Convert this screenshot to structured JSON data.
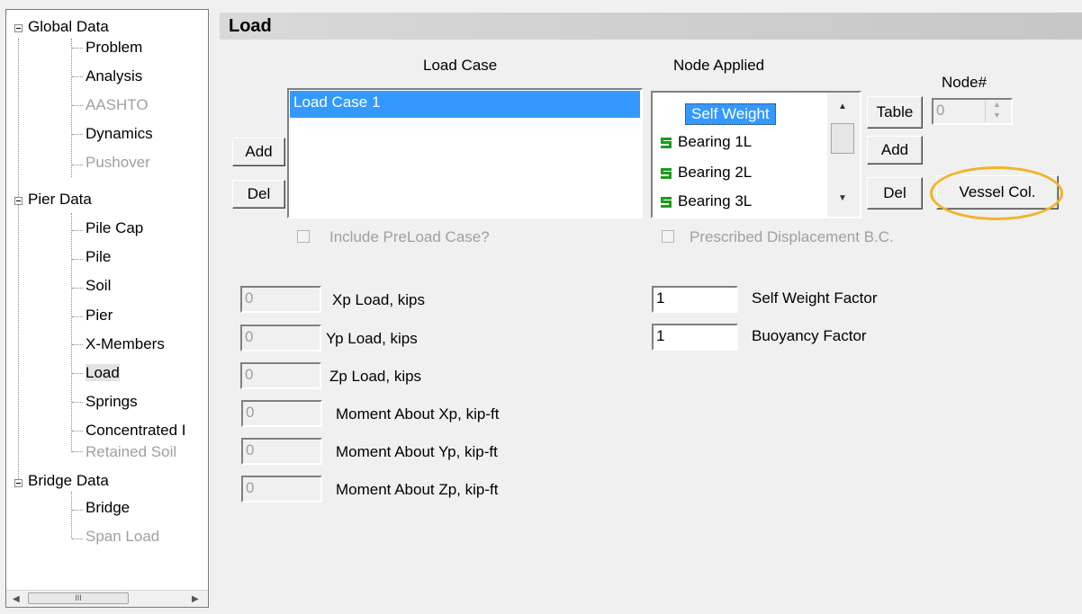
{
  "tree": {
    "groups": [
      {
        "label": "Global Data",
        "children": [
          {
            "label": "Problem",
            "disabled": false
          },
          {
            "label": "Analysis",
            "disabled": false
          },
          {
            "label": "AASHTO",
            "disabled": true
          },
          {
            "label": "Dynamics",
            "disabled": false
          },
          {
            "label": "Pushover",
            "disabled": true
          }
        ]
      },
      {
        "label": "Pier Data",
        "children": [
          {
            "label": "Pile Cap",
            "disabled": false
          },
          {
            "label": "Pile",
            "disabled": false
          },
          {
            "label": "Soil",
            "disabled": false
          },
          {
            "label": "Pier",
            "disabled": false
          },
          {
            "label": "X-Members",
            "disabled": false
          },
          {
            "label": "Load",
            "disabled": false,
            "selected": true
          },
          {
            "label": "Springs",
            "disabled": false
          },
          {
            "label": "Concentrated I",
            "disabled": false
          },
          {
            "label": "Retained Soil",
            "disabled": true
          }
        ]
      },
      {
        "label": "Bridge Data",
        "children": [
          {
            "label": "Bridge",
            "disabled": false
          },
          {
            "label": "Span Load",
            "disabled": true
          }
        ]
      }
    ],
    "scroll_thumb": "III"
  },
  "panel": {
    "title": "Load",
    "load_case_header": "Load Case",
    "load_cases": [
      "Load Case 1"
    ],
    "add_label": "Add",
    "del_label": "Del",
    "node_applied_header": "Node Applied",
    "nodes": [
      {
        "label": "Self Weight",
        "icon": "none",
        "selected": true
      },
      {
        "label": "Bearing 1L",
        "icon": "spring-icon"
      },
      {
        "label": "Bearing 2L",
        "icon": "spring-icon"
      },
      {
        "label": "Bearing 3L",
        "icon": "spring-icon"
      }
    ],
    "table_label": "Table",
    "node_add_label": "Add",
    "node_del_label": "Del",
    "node_num_label": "Node#",
    "node_num_value": "0",
    "vessel_label": "Vessel Col.",
    "include_preload": "Include PreLoad Case?",
    "prescribed_disp": "Prescribed Displacement B.C.",
    "loads": [
      {
        "value": "0",
        "label": "Xp Load, kips"
      },
      {
        "value": "0",
        "label": "Yp Load, kips"
      },
      {
        "value": "0",
        "label": "Zp Load, kips"
      },
      {
        "value": "0",
        "label": "Moment About Xp, kip-ft"
      },
      {
        "value": "0",
        "label": "Moment About Yp, kip-ft"
      },
      {
        "value": "0",
        "label": "Moment About Zp, kip-ft"
      }
    ],
    "self_weight_factor": {
      "value": "1",
      "label": "Self Weight Factor"
    },
    "buoyancy_factor": {
      "value": "1",
      "label": "Buoyancy Factor"
    }
  },
  "colors": {
    "selection": "#3399ff",
    "highlight_ring": "#f0b32b",
    "spring_icon": "#1c9c1c"
  }
}
